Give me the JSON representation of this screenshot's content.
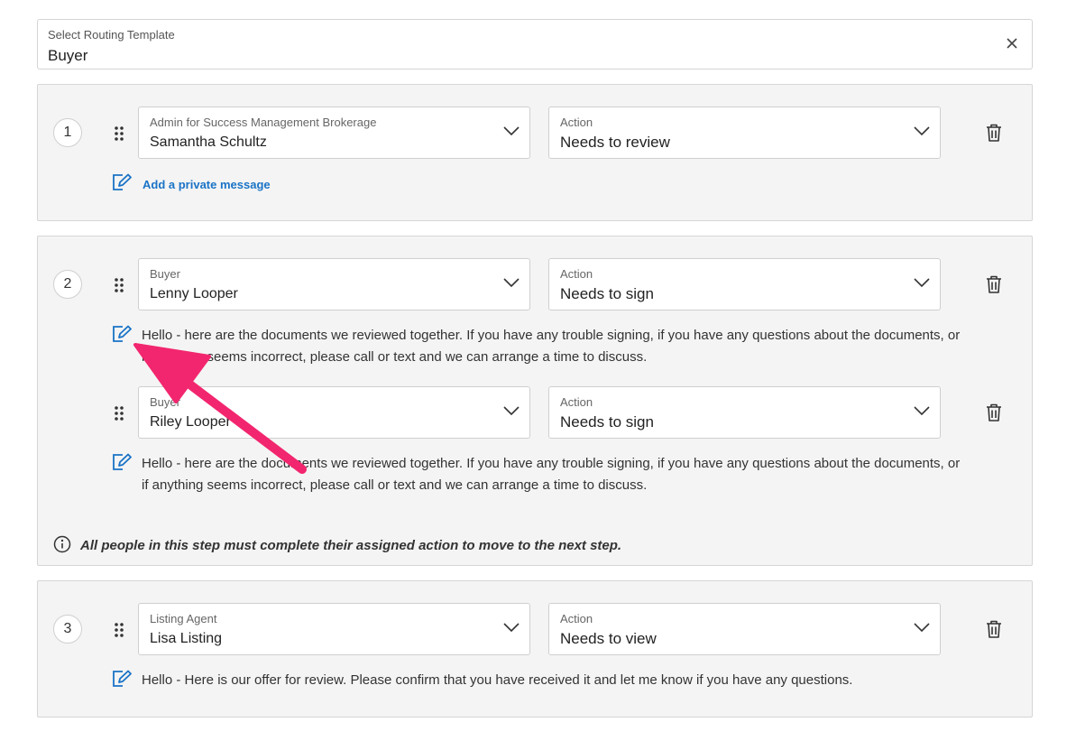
{
  "template": {
    "label": "Select Routing Template",
    "value": "Buyer"
  },
  "steps": [
    {
      "number": "1",
      "recipients": [
        {
          "role": "Admin for Success Management Brokerage",
          "name": "Samantha Schultz",
          "action_label": "Action",
          "action_value": "Needs to review",
          "message_link": "Add a private message"
        }
      ]
    },
    {
      "number": "2",
      "recipients": [
        {
          "role": "Buyer",
          "name": "Lenny Looper",
          "action_label": "Action",
          "action_value": "Needs to sign",
          "message": "Hello - here are the documents we reviewed together. If you have any trouble signing, if you have any questions about the documents, or if anything seems incorrect, please call or text and we can arrange a time to discuss."
        },
        {
          "role": "Buyer",
          "name": "Riley Looper",
          "action_label": "Action",
          "action_value": "Needs to sign",
          "message": "Hello - here are the documents we reviewed together. If you have any trouble signing, if you have any questions about the documents, or if anything seems incorrect, please call or text and we can arrange a time to discuss."
        }
      ],
      "info": "All people in this step must complete their assigned action to move to the next step."
    },
    {
      "number": "3",
      "recipients": [
        {
          "role": "Listing Agent",
          "name": "Lisa Listing",
          "action_label": "Action",
          "action_value": "Needs to view",
          "message": "Hello - Here is our offer for review. Please confirm that you have received it and let me know if you have any questions."
        }
      ]
    }
  ],
  "icons": {
    "clear": "close-icon",
    "drag": "drag-handle-icon",
    "chevron": "chevron-down-icon",
    "delete": "trash-icon",
    "message": "edit-message-icon",
    "info": "info-icon"
  },
  "colors": {
    "accent": "#1a73c6",
    "annotation_arrow": "#f2266e",
    "step_background": "#f4f4f4"
  }
}
